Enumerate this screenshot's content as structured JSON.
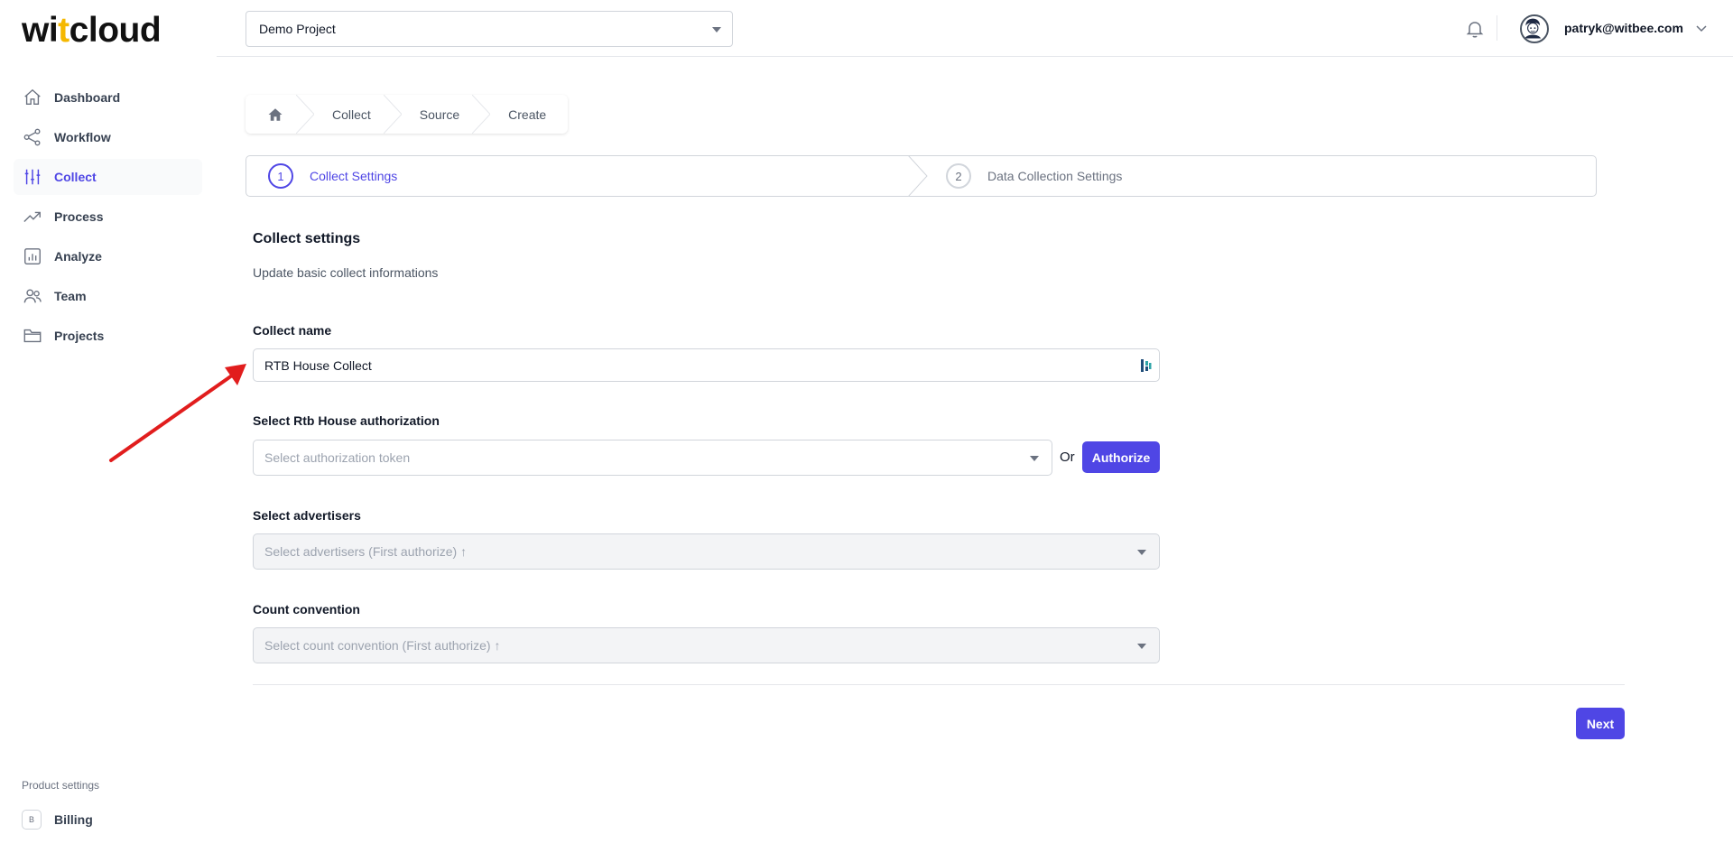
{
  "brand": {
    "logo_part1": "wi",
    "logo_accent": "t",
    "logo_part2": "cloud"
  },
  "sidebar": {
    "items": [
      {
        "label": "Dashboard",
        "icon": "home-icon"
      },
      {
        "label": "Workflow",
        "icon": "share-icon"
      },
      {
        "label": "Collect",
        "icon": "sliders-icon",
        "active": true
      },
      {
        "label": "Process",
        "icon": "trending-up-icon"
      },
      {
        "label": "Analyze",
        "icon": "chart-bar-icon"
      },
      {
        "label": "Team",
        "icon": "users-icon"
      },
      {
        "label": "Projects",
        "icon": "folder-icon"
      }
    ],
    "product_settings": "Product settings",
    "billing": {
      "badge": "B",
      "label": "Billing"
    }
  },
  "header": {
    "project": "Demo Project",
    "user_email": "patryk@witbee.com"
  },
  "breadcrumb": {
    "items": [
      "Collect",
      "Source",
      "Create"
    ]
  },
  "steps": [
    {
      "number": "1",
      "label": "Collect Settings",
      "active": true
    },
    {
      "number": "2",
      "label": "Data Collection Settings",
      "active": false
    }
  ],
  "form": {
    "title": "Collect settings",
    "subtitle": "Update basic collect informations",
    "collect_name": {
      "label": "Collect name",
      "value": "RTB House Collect"
    },
    "authorization": {
      "label": "Select Rtb House authorization",
      "placeholder": "Select authorization token",
      "or_text": "Or",
      "button": "Authorize"
    },
    "advertisers": {
      "label": "Select advertisers",
      "placeholder": "Select advertisers (First authorize) ↑"
    },
    "count_convention": {
      "label": "Count convention",
      "placeholder": "Select count convention (First authorize) ↑"
    },
    "next_button": "Next"
  },
  "colors": {
    "accent": "#4f46e5",
    "logo_accent": "#f5b800",
    "annotation_arrow": "#e11d1d"
  }
}
